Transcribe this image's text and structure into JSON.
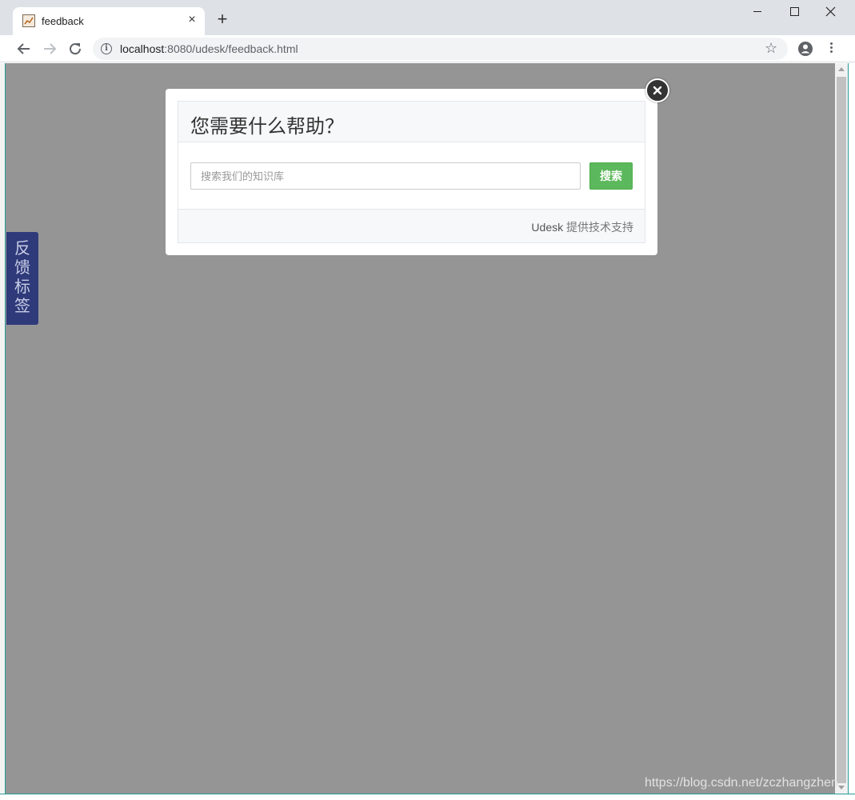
{
  "browser": {
    "tab_title": "feedback",
    "tab_close": "×",
    "new_tab": "+",
    "url_host": "localhost",
    "url_rest": ":8080/udesk/feedback.html",
    "info_glyph": "i",
    "star_glyph": "☆"
  },
  "side_tab": {
    "label": "反馈标签"
  },
  "modal": {
    "title": "您需要什么帮助？",
    "search_placeholder": "搜索我们的知识库",
    "search_button": "搜索",
    "footer_brand": "Udesk",
    "footer_support": " 提供技术支持"
  },
  "watermark": "https://blog.csdn.net/zczhangzhen",
  "colors": {
    "overlay": "#959595",
    "side_tab": "#2f3a7a",
    "search_button": "#5cb85c",
    "close_button": "#333333"
  },
  "icons": [
    "favicon-icon",
    "close-icon",
    "plus-icon",
    "back-arrow-icon",
    "forward-arrow-icon",
    "reload-icon",
    "info-icon",
    "star-icon",
    "profile-icon",
    "menu-dots-icon",
    "modal-close-icon"
  ]
}
